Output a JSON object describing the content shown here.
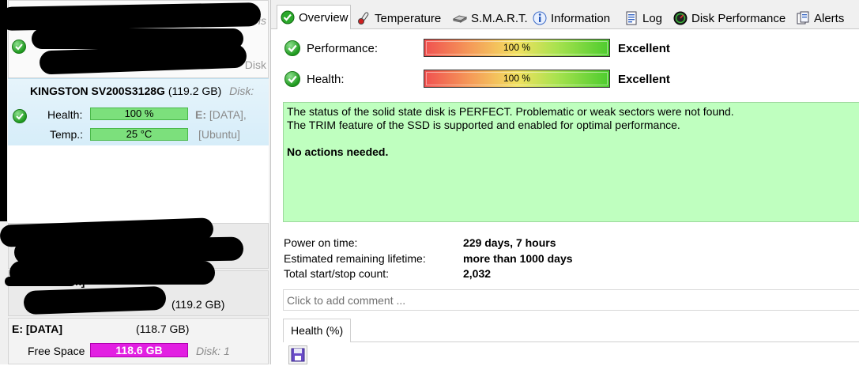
{
  "disks": {
    "selected": {
      "model": "KINGSTON SV200S3128G",
      "capacity": "(119.2 GB)",
      "disk_label": "Disk:",
      "health_label": "Health:",
      "health_value": "100 %",
      "temp_label": "Temp.:",
      "temp_value": "25 °C",
      "drive_letter": "E:",
      "drive_name": "[DATA],",
      "drive_name2": "[Ubuntu]"
    },
    "first_disk_partial": "Disk",
    "first_disk_partial2": "Dis",
    "second_disk_partial": "k]",
    "second_disk_capacity_partial": "(119.2 GB)"
  },
  "volume": {
    "name": "E: [DATA]",
    "capacity": "(118.7 GB)",
    "free_label": "Free Space",
    "free_value": "118.6 GB",
    "disk_label": "Disk: 1",
    "bar_color": "#e21fe2"
  },
  "tabs": [
    {
      "label": "Overview",
      "icon": "green-check-icon",
      "active": true
    },
    {
      "label": "Temperature",
      "icon": "thermometer-icon",
      "active": false
    },
    {
      "label": "S.M.A.R.T.",
      "icon": "hard-drive-icon",
      "active": false
    },
    {
      "label": "Information",
      "icon": "info-icon",
      "active": false
    },
    {
      "label": "Log",
      "icon": "log-document-icon",
      "active": false
    },
    {
      "label": "Disk Performance",
      "icon": "speedometer-icon",
      "active": false
    },
    {
      "label": "Alerts",
      "icon": "alerts-icon",
      "active": false
    }
  ],
  "overview": {
    "performance_label": "Performance:",
    "performance_value": "100 %",
    "performance_status": "Excellent",
    "health_label": "Health:",
    "health_value": "100 %",
    "health_status": "Excellent",
    "status_line1": "The status of the solid state disk is PERFECT. Problematic or weak sectors were not found.",
    "status_line2": "The TRIM feature of the SSD is supported and enabled for optimal performance.",
    "status_actions": "No actions needed.",
    "status_bg": "#bfffbf",
    "power_on_label": "Power on time:",
    "power_on_value": "229 days, 7 hours",
    "lifetime_label": "Estimated remaining lifetime:",
    "lifetime_value": "more than 1000 days",
    "startstop_label": "Total start/stop count:",
    "startstop_value": "2,032",
    "comment_placeholder": "Click to add comment ...",
    "bottom_tab": "Health (%)"
  }
}
